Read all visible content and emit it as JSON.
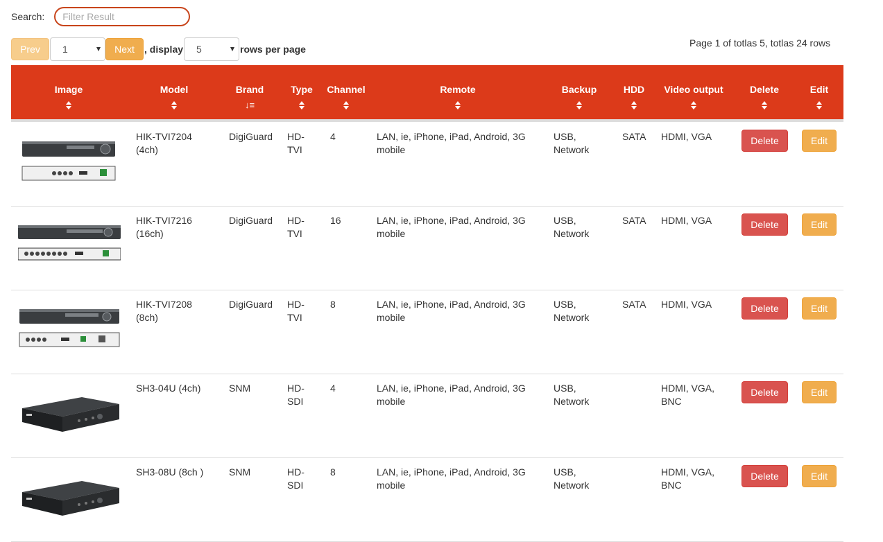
{
  "search": {
    "label": "Search:",
    "placeholder": "Filter Result",
    "value": ""
  },
  "pager": {
    "prev_label": "Prev",
    "next_label": "Next",
    "page_value": "1",
    "display_text": ", display",
    "rows_value": "5",
    "rows_text": "rows per page",
    "info": "Page 1 of totlas 5, totlas 24 rows"
  },
  "colors": {
    "header_bg": "#dc3a1a",
    "prev_bg": "#f7cd8c",
    "next_bg": "#f0ad4e",
    "delete_bg": "#d9534f",
    "edit_bg": "#f0ad4e",
    "search_border": "#c8441a"
  },
  "columns": [
    "Image",
    "Model",
    "Brand",
    "Type",
    "Channel",
    "Remote",
    "Backup",
    "HDD",
    "Video output",
    "Delete",
    "Edit"
  ],
  "sorted_column": "Brand",
  "rows": [
    {
      "model": "HIK-TVI7204 (4ch)",
      "brand": "DigiGuard",
      "type": "HD-TVI",
      "channel": "4",
      "remote": "LAN, ie, iPhone, iPad, Android, 3G mobile",
      "backup": "USB, Network",
      "hdd": "SATA",
      "video_output": "HDMI, VGA",
      "delete_label": "Delete",
      "edit_label": "Edit",
      "image_icon": "dvr-front-back-4ch-image"
    },
    {
      "model": "HIK-TVI7216 (16ch)",
      "brand": "DigiGuard",
      "type": "HD-TVI",
      "channel": "16",
      "remote": "LAN, ie, iPhone, iPad, Android, 3G mobile",
      "backup": "USB, Network",
      "hdd": "SATA",
      "video_output": "HDMI, VGA",
      "delete_label": "Delete",
      "edit_label": "Edit",
      "image_icon": "dvr-front-back-16ch-image"
    },
    {
      "model": "HIK-TVI7208 (8ch)",
      "brand": "DigiGuard",
      "type": "HD-TVI",
      "channel": "8",
      "remote": "LAN, ie, iPhone, iPad, Android, 3G mobile",
      "backup": "USB, Network",
      "hdd": "SATA",
      "video_output": "HDMI, VGA",
      "delete_label": "Delete",
      "edit_label": "Edit",
      "image_icon": "dvr-front-back-8ch-image"
    },
    {
      "model": "SH3-04U (4ch)",
      "brand": "SNM",
      "type": "HD-SDI",
      "channel": "4",
      "remote": "LAN, ie, iPhone, iPad, Android, 3G mobile",
      "backup": "USB, Network",
      "hdd": "",
      "video_output": "HDMI, VGA, BNC",
      "delete_label": "Delete",
      "edit_label": "Edit",
      "image_icon": "dvr-perspective-image"
    },
    {
      "model": "SH3-08U (8ch )",
      "brand": "SNM",
      "type": "HD-SDI",
      "channel": "8",
      "remote": "LAN, ie, iPhone, iPad, Android, 3G mobile",
      "backup": "USB, Network",
      "hdd": "",
      "video_output": "HDMI, VGA, BNC",
      "delete_label": "Delete",
      "edit_label": "Edit",
      "image_icon": "dvr-perspective-image"
    }
  ]
}
